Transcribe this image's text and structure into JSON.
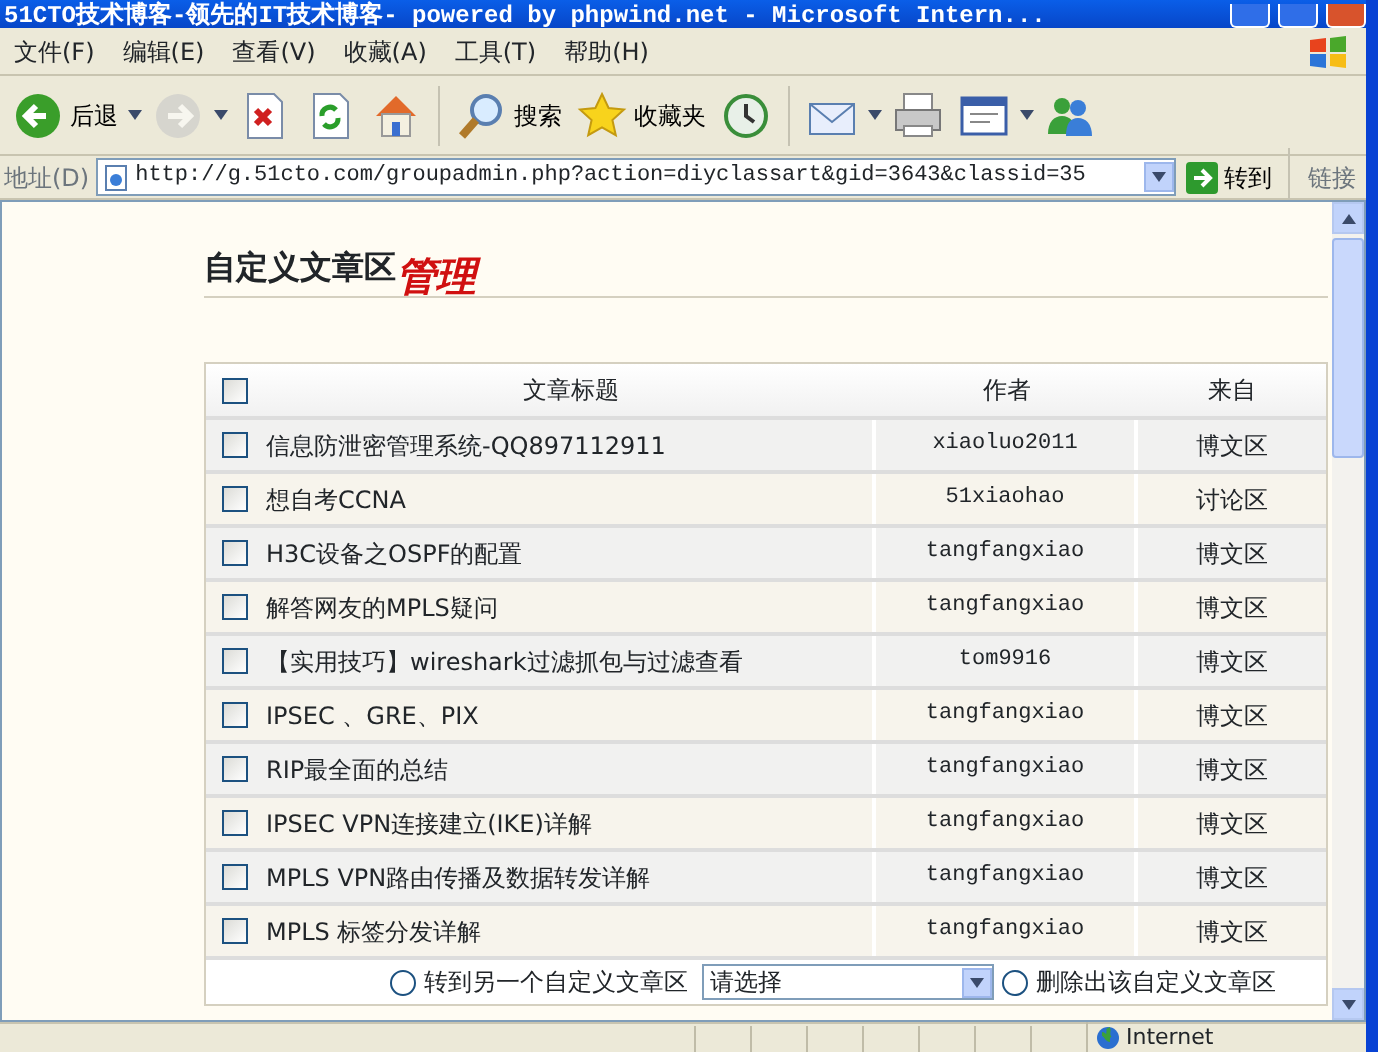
{
  "window": {
    "title": "51CTO技术博客-领先的IT技术博客- powered by phpwind.net - Microsoft Intern..."
  },
  "menu": [
    {
      "label": "文件(F)"
    },
    {
      "label": "编辑(E)"
    },
    {
      "label": "查看(V)"
    },
    {
      "label": "收藏(A)"
    },
    {
      "label": "工具(T)"
    },
    {
      "label": "帮助(H)"
    }
  ],
  "toolbar": [
    {
      "kind": "back",
      "label": "后退",
      "dropdown": true,
      "disabled": false
    },
    {
      "kind": "forward",
      "dropdown": true,
      "disabled": true
    },
    {
      "kind": "stop",
      "dropdown": false,
      "disabled": false
    },
    {
      "kind": "refresh",
      "dropdown": false,
      "disabled": false
    },
    {
      "kind": "home",
      "dropdown": false,
      "disabled": false
    },
    {
      "kind": "search",
      "label": "搜索",
      "dropdown": false,
      "disabled": false
    },
    {
      "kind": "favorites",
      "label": "收藏夹",
      "dropdown": false,
      "disabled": false
    },
    {
      "kind": "history",
      "dropdown": false,
      "disabled": false
    },
    {
      "kind": "mail",
      "dropdown": true,
      "disabled": false
    },
    {
      "kind": "print",
      "dropdown": false,
      "disabled": false
    },
    {
      "kind": "edit",
      "dropdown": true,
      "disabled": false
    },
    {
      "kind": "messenger",
      "dropdown": false,
      "disabled": false
    }
  ],
  "address_bar": {
    "label": "地址(D)",
    "url": "http://g.51cto.com/groupadmin.php?action=diyclassart&gid=3643&classid=35",
    "go": "转到",
    "links": "链接"
  },
  "page": {
    "heading": "自定义文章区",
    "heading_art": "管理",
    "table": {
      "columns": [
        "文章标题",
        "作者",
        "来自"
      ],
      "header_checked": false,
      "rows": [
        {
          "title": "信息防泄密管理系统-QQ897112911",
          "author": "xiaoluo2011",
          "source": "博文区",
          "checked": false
        },
        {
          "title": "想自考CCNA",
          "author": "51xiaohao",
          "source": "讨论区",
          "checked": false
        },
        {
          "title": "H3C设备之OSPF的配置",
          "author": "tangfangxiao",
          "source": "博文区",
          "checked": false
        },
        {
          "title": "解答网友的MPLS疑问",
          "author": "tangfangxiao",
          "source": "博文区",
          "checked": false
        },
        {
          "title": "【实用技巧】wireshark过滤抓包与过滤查看",
          "author": "tom9916",
          "source": "博文区",
          "checked": false
        },
        {
          "title": "IPSEC 、GRE、PIX",
          "author": "tangfangxiao",
          "source": "博文区",
          "checked": false
        },
        {
          "title": "RIP最全面的总结",
          "author": "tangfangxiao",
          "source": "博文区",
          "checked": false
        },
        {
          "title": "IPSEC VPN连接建立(IKE)详解",
          "author": "tangfangxiao",
          "source": "博文区",
          "checked": false
        },
        {
          "title": "MPLS VPN路由传播及数据转发详解",
          "author": "tangfangxiao",
          "source": "博文区",
          "checked": false
        },
        {
          "title": "MPLS 标签分发详解",
          "author": "tangfangxiao",
          "source": "博文区",
          "checked": false
        }
      ]
    },
    "actions": [
      {
        "label": "转到另一个自定义文章区",
        "selected": false
      },
      {
        "label": "删除出该自定义文章区",
        "selected": false
      }
    ],
    "select": {
      "value": "请选择"
    }
  },
  "status_bar": {
    "zone": "Internet"
  }
}
